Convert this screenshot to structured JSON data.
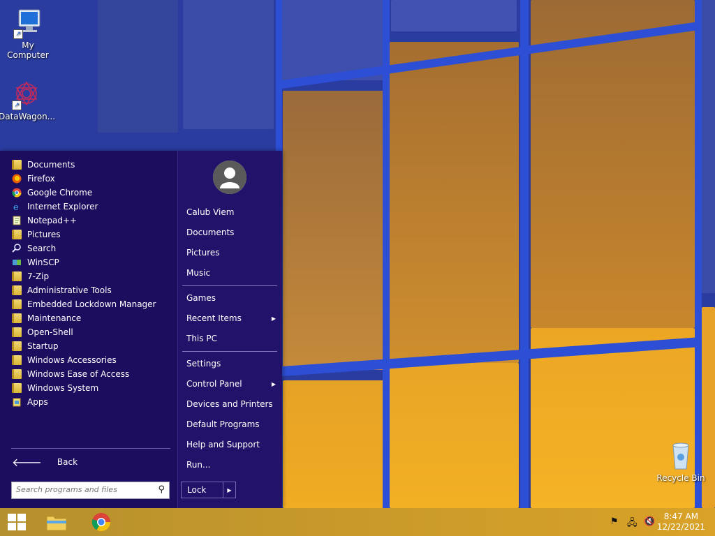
{
  "desktop": {
    "icons": [
      {
        "label": "My Computer",
        "icon": "computer-icon"
      },
      {
        "label": "DataWagon...",
        "icon": "datawagon-icon"
      },
      {
        "label": "Recycle Bin",
        "icon": "recycle-bin-icon"
      }
    ]
  },
  "start_menu": {
    "programs": [
      {
        "label": "Documents",
        "icon": "folder-icon"
      },
      {
        "label": "Firefox",
        "icon": "firefox-icon"
      },
      {
        "label": "Google Chrome",
        "icon": "chrome-icon"
      },
      {
        "label": "Internet Explorer",
        "icon": "ie-icon"
      },
      {
        "label": "Notepad++",
        "icon": "notepad-icon"
      },
      {
        "label": "Pictures",
        "icon": "folder-icon"
      },
      {
        "label": "Search",
        "icon": "search-icon"
      },
      {
        "label": "WinSCP",
        "icon": "winscp-icon"
      },
      {
        "label": "7-Zip",
        "icon": "folder-icon"
      },
      {
        "label": "Administrative Tools",
        "icon": "folder-icon"
      },
      {
        "label": "Embedded Lockdown Manager",
        "icon": "folder-icon"
      },
      {
        "label": "Maintenance",
        "icon": "folder-icon"
      },
      {
        "label": "Open-Shell",
        "icon": "folder-icon"
      },
      {
        "label": "Startup",
        "icon": "folder-icon"
      },
      {
        "label": "Windows Accessories",
        "icon": "folder-icon"
      },
      {
        "label": "Windows Ease of Access",
        "icon": "folder-icon"
      },
      {
        "label": "Windows System",
        "icon": "folder-icon"
      },
      {
        "label": "Apps",
        "icon": "apps-icon"
      }
    ],
    "back_label": "Back",
    "search_placeholder": "Search programs and files",
    "user_name": "Calub Viem",
    "right_items": [
      {
        "label": "Documents",
        "submenu": false
      },
      {
        "label": "Pictures",
        "submenu": false
      },
      {
        "label": "Music",
        "submenu": false
      },
      {
        "label": "Games",
        "submenu": false
      },
      {
        "label": "Recent Items",
        "submenu": true
      },
      {
        "label": "This PC",
        "submenu": false
      },
      {
        "label": "Settings",
        "submenu": false
      },
      {
        "label": "Control Panel",
        "submenu": true
      },
      {
        "label": "Devices and Printers",
        "submenu": false
      },
      {
        "label": "Default Programs",
        "submenu": false
      },
      {
        "label": "Help and Support",
        "submenu": false
      },
      {
        "label": "Run...",
        "submenu": false
      }
    ],
    "lock_label": "Lock"
  },
  "taskbar": {
    "pinned": [
      {
        "name": "start-button",
        "icon": "windows-logo-icon"
      },
      {
        "name": "file-explorer",
        "icon": "file-explorer-icon"
      },
      {
        "name": "chrome",
        "icon": "chrome-icon"
      }
    ],
    "clock": {
      "time": "8:47 AM",
      "date": "12/22/2021"
    }
  },
  "colors": {
    "menu_bg": "#1d0d5e",
    "taskbar_bg": "#c99a2a",
    "folder": "#e6c455"
  }
}
